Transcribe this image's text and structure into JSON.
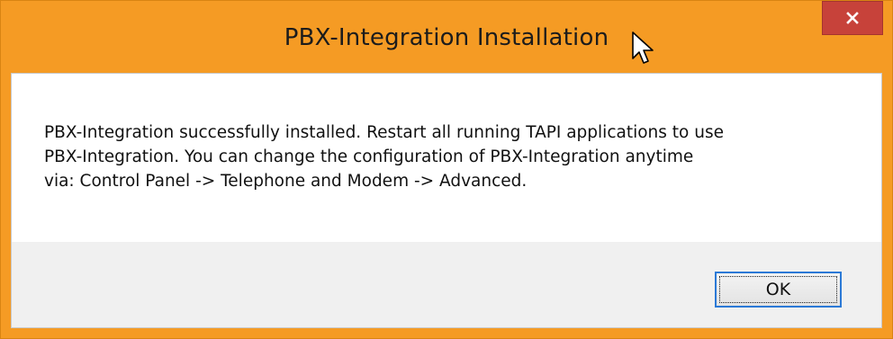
{
  "window": {
    "title": "PBX-Integration Installation",
    "close_icon": "close-icon",
    "accent_color": "#f59b24",
    "close_color": "#c7423a"
  },
  "message": {
    "lines": [
      "PBX-Integration successfully installed. Restart all running TAPI applications to use",
      "PBX-Integration. You can change the configuration of PBX-Integration anytime",
      "via: Control Panel -> Telephone and Modem -> Advanced."
    ]
  },
  "buttons": {
    "ok_label": "OK"
  },
  "cursor": {
    "icon": "mouse-pointer-icon"
  }
}
